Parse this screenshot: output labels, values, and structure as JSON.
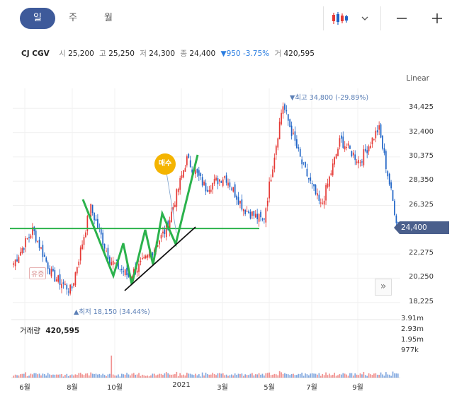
{
  "tabs": [
    "일",
    "주",
    "월"
  ],
  "active_tab": "일",
  "stock": {
    "name": "CJ CGV",
    "open_label": "시",
    "open": "25,200",
    "high_label": "고",
    "high": "25,250",
    "low_label": "저",
    "low": "24,300",
    "close_label": "종",
    "close": "24,400",
    "change": "▼950 -3.75%",
    "volume_label": "거",
    "volume": "420,595"
  },
  "scale_label": "Linear",
  "current_price_tag": "24,400",
  "annotations": {
    "high": "▼최고 34,800 (-29.89%)",
    "low": "▲최저 18,150 (34.44%)",
    "buy": "매수",
    "badge": "유증"
  },
  "volume_panel": {
    "label": "거래량",
    "value": "420,595"
  },
  "colors": {
    "up": "#e53935",
    "down": "#1e63c6",
    "trend": "#2bb24c",
    "tab_active": "#3e5a9a",
    "buy_badge": "#f4b400"
  },
  "icons": {
    "chart_type": "candle-icon",
    "dropdown": "chevron-down-icon",
    "zoom_out": "minus-icon",
    "zoom_in": "plus-icon",
    "expand": "double-chevron-right-icon"
  },
  "chart_data": [
    {
      "type": "candlestick",
      "title": "CJ CGV",
      "xlabel": "",
      "ylabel": "",
      "yscale": "linear",
      "ylim": [
        17500,
        35800
      ],
      "y_ticks": [
        "34,425",
        "32,400",
        "30,375",
        "28,350",
        "26,325",
        "24,400",
        "22,275",
        "20,250",
        "18,225"
      ],
      "x_ticks": [
        "6월",
        "8월",
        "10월",
        "2021",
        "3월",
        "5월",
        "7월",
        "9월"
      ],
      "approx_close_path": [
        {
          "x": "2020-06",
          "y": 21500
        },
        {
          "x": "2020-06",
          "y": 24300
        },
        {
          "x": "2020-07",
          "y": 20500
        },
        {
          "x": "2020-08",
          "y": 19200
        },
        {
          "x": "2020-08",
          "y": 26200
        },
        {
          "x": "2020-09",
          "y": 21800
        },
        {
          "x": "2020-10",
          "y": 20400
        },
        {
          "x": "2020-11",
          "y": 22000
        },
        {
          "x": "2020-12",
          "y": 24500
        },
        {
          "x": "2021-01",
          "y": 30200
        },
        {
          "x": "2021-02",
          "y": 27800
        },
        {
          "x": "2021-03",
          "y": 28800
        },
        {
          "x": "2021-04",
          "y": 26000
        },
        {
          "x": "2021-05",
          "y": 25000
        },
        {
          "x": "2021-06",
          "y": 34800
        },
        {
          "x": "2021-07",
          "y": 29800
        },
        {
          "x": "2021-08",
          "y": 26200
        },
        {
          "x": "2021-09",
          "y": 31800
        },
        {
          "x": "2021-10",
          "y": 30000
        },
        {
          "x": "2021-10",
          "y": 32800
        },
        {
          "x": "2021-10",
          "y": 24400
        }
      ],
      "high": 34800,
      "low": 18150,
      "last": 24400,
      "annotations": [
        "horizontal support line 24,400",
        "zigzag trend lines",
        "ascending trend line",
        "매수"
      ]
    },
    {
      "type": "bar",
      "title": "거래량",
      "y_ticks": [
        "3.91m",
        "2.93m",
        "1.95m",
        "977k"
      ],
      "ylim": [
        0,
        4300000
      ],
      "last_volume": 420595
    }
  ]
}
